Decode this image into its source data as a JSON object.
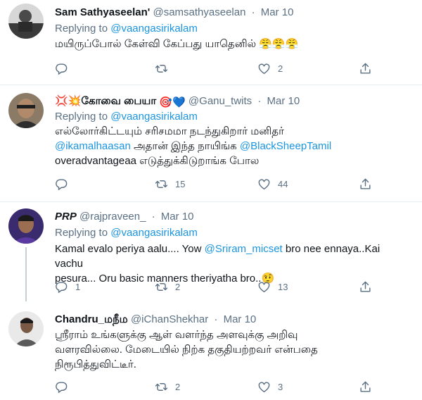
{
  "colors": {
    "accent": "#1b95e0",
    "muted": "#5b7083",
    "text": "#0f1419",
    "divider": "#e6ecf0"
  },
  "tweets": [
    {
      "name": "Sam Sathyaseelan'",
      "handle": "@samsathyaseelan",
      "date": "Mar 10",
      "replying_prefix": "Replying to ",
      "replying_to": "@vaangasirikalam",
      "text": "மயிருப்போல் கேள்வி கேப்பது யாதெனில் 😤😤😤",
      "replies": "",
      "retweets": "",
      "likes": "2"
    },
    {
      "name_prefix": "💢💥கோவை பையா",
      "name_suffix": "🎯💙",
      "handle": "@Ganu_twits",
      "date": "Mar 10",
      "replying_prefix": "Replying to ",
      "replying_to": "@vaangasirikalam",
      "line1": "எல்லோர்கிட்டயும் சரிசமமா நடந்துகிறார் மனிதர்",
      "mention1": "@ikamalhaasan",
      "line2_mid": " அதான் இந்த நாயிங்க ",
      "mention2": "@BlackSheepTamil",
      "line3": "overadvantageaa எடுத்துக்கிடுறாங்க போல",
      "replies": "",
      "retweets": "15",
      "likes": "44"
    },
    {
      "name": "PRP",
      "handle": "@rajpraveen_",
      "date": "Mar 10",
      "replying_prefix": "Replying to ",
      "replying_to": "@vaangasirikalam",
      "text_a": "Kamal evalo periya aalu.... Yow ",
      "mention": "@Sriram_micset",
      "text_b": " bro nee ennaya..Kai vachu",
      "text_c": "pesura... Oru basic manners theriyatha bro..🤨",
      "replies": "1",
      "retweets": "2",
      "likes": "13"
    },
    {
      "name": "Chandru_மநீம",
      "handle": "@iChanShekhar",
      "date": "Mar 10",
      "line1": "ஸ்ரீராம் உங்களுக்கு ஆள் வளர்ந்த அளவுக்கு அறிவு",
      "line2": "வளரவில்லை. மேடையில் நிற்க தகுதியற்றவர் என்பதை",
      "line3": "நிரூபித்துவிட்டீர்.",
      "replies": "",
      "retweets": "2",
      "likes": "3"
    }
  ]
}
